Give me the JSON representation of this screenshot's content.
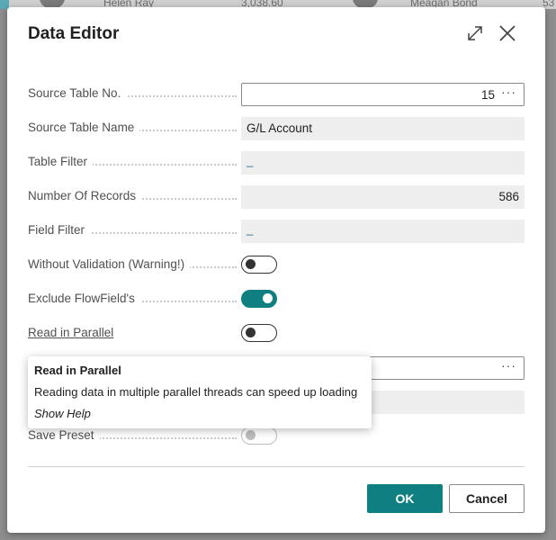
{
  "background": {
    "items": [
      "Helen Ray",
      "3,038.60",
      "Meagan Bond",
      "53"
    ]
  },
  "dialog": {
    "title": "Data Editor",
    "icons": {
      "expand": "expand-diagonal-icon",
      "close": "close-icon"
    }
  },
  "fields": {
    "source_table_no": {
      "label": "Source Table No.",
      "value": "15"
    },
    "source_table_name": {
      "label": "Source Table Name",
      "value": "G/L Account"
    },
    "table_filter": {
      "label": "Table Filter",
      "value": "_"
    },
    "number_of_records": {
      "label": "Number Of Records",
      "value": "586"
    },
    "field_filter": {
      "label": "Field Filter",
      "value": "_"
    },
    "without_validation": {
      "label": "Without Validation (Warning!)",
      "on": false
    },
    "exclude_flowfields": {
      "label": "Exclude FlowField's",
      "on": true
    },
    "read_in_parallel": {
      "label": "Read in Parallel",
      "on": false
    },
    "save_preset": {
      "label": "Save Preset",
      "on": false
    }
  },
  "tooltip": {
    "title": "Read in Parallel",
    "body": "Reading data in multiple parallel threads can speed up loading",
    "help": "Show Help"
  },
  "buttons": {
    "ok": "OK",
    "cancel": "Cancel"
  },
  "colors": {
    "accent": "#0f7f82",
    "link": "#1a6a86"
  }
}
